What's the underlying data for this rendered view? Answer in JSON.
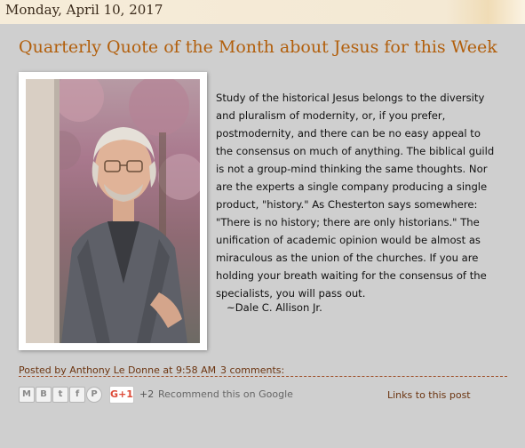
{
  "date_header": "Monday, April 10, 2017",
  "post": {
    "title": "Quarterly Quote of the Month about Jesus for this Week",
    "quote": "Study of the historical Jesus belongs to the diversity and pluralism of modernity, or, if you prefer, postmodernity, and there can be no easy appeal to the consensus on much of anything. The biblical guild is not a group-mind thinking the same thoughts. Nor are the experts a single company producing a single product, \"history.\" As Chesterton says somewhere: \"There is no history; there are only historians.\" The unification of academic opinion would be almost as miraculous as the union of the churches. If you are holding your breath waiting for the consensus of the specialists, you will pass out.",
    "attribution": "~Dale C. Allison Jr."
  },
  "footer": {
    "posted_by_label": "Posted by",
    "author": "Anthony Le Donne",
    "at_label": "at",
    "time": "9:58 AM",
    "comments": "3 comments:"
  },
  "share": {
    "email_icon": "M",
    "blog_icon": "B",
    "twitter_icon": "t",
    "facebook_icon": "f",
    "pinterest_icon": "P",
    "gplus_label": "G+1",
    "gplus_count": "+2",
    "recommend_text": "Recommend this on Google"
  },
  "links_to_post": "Links to this post",
  "colors": {
    "title": "#b25f0c",
    "post_background": "#cfcfcf",
    "page_background": "#f4ead7",
    "footer_text": "#6b3410"
  }
}
